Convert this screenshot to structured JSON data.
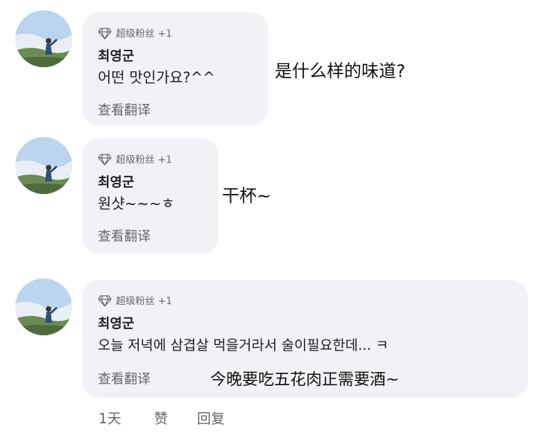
{
  "comments": [
    {
      "badge": "超级粉丝 +1",
      "author": "최영군",
      "message": "어떤 맛인가요?^^",
      "translate": "查看翻译",
      "overlay": "是什么样的味道?"
    },
    {
      "badge": "超级粉丝 +1",
      "author": "최영군",
      "message": "원샷~~~ㅎ",
      "translate": "查看翻译",
      "overlay": "干杯~"
    },
    {
      "badge": "超级粉丝 +1",
      "author": "최영군",
      "message": "오늘 저녁에 삼겹살 먹을거라서 술이필요한데... ㅋ",
      "translate": "查看翻译",
      "overlay": "今晚要吃五花肉正需要酒~"
    }
  ],
  "actions": {
    "time": "1天",
    "like": "赞",
    "reply": "回复"
  },
  "icons": {
    "badge": "diamond-icon",
    "avatar": "profile-photo"
  },
  "colors": {
    "bubble_bg": "#f0f2f5",
    "secondary_text": "#65676b",
    "primary_text": "#1c1e21"
  }
}
